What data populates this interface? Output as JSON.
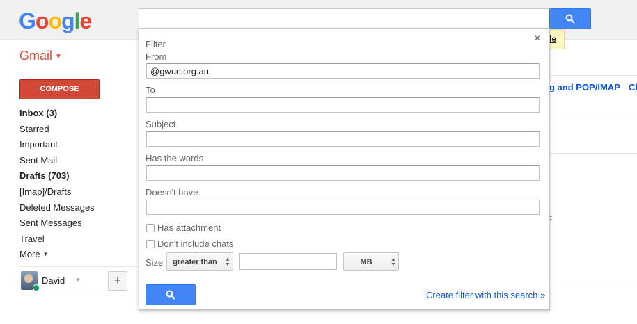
{
  "header": {
    "logo_letters": [
      {
        "ch": "G",
        "color": "#4285f4"
      },
      {
        "ch": "o",
        "color": "#ea4335"
      },
      {
        "ch": "o",
        "color": "#fbbc05"
      },
      {
        "ch": "g",
        "color": "#4285f4"
      },
      {
        "ch": "l",
        "color": "#34a853"
      },
      {
        "ch": "e",
        "color": "#ea4335"
      }
    ],
    "search_value": "",
    "search_icon": "magnifier-icon",
    "tooltip_text": "le"
  },
  "sidebar": {
    "app_label": "Gmail",
    "compose_label": "COMPOSE",
    "items": [
      {
        "label": "Inbox (3)",
        "bold": true
      },
      {
        "label": "Starred",
        "bold": false
      },
      {
        "label": "Important",
        "bold": false
      },
      {
        "label": "Sent Mail",
        "bold": false
      },
      {
        "label": "Drafts (703)",
        "bold": true
      },
      {
        "label": "[Imap]/Drafts",
        "bold": false
      },
      {
        "label": "Deleted Messages",
        "bold": false
      },
      {
        "label": "Sent Messages",
        "bold": false
      },
      {
        "label": "Travel",
        "bold": false
      }
    ],
    "more_label": "More",
    "user_name": "David",
    "add_label": "+"
  },
  "background": {
    "settings_link": "g and POP/IMAP",
    "settings_link_2": "Ch",
    "colon": ":"
  },
  "filter": {
    "title": "Filter",
    "close_label": "×",
    "from_label": "From",
    "from_value": "@gwuc.org.au",
    "to_label": "To",
    "to_value": "",
    "subject_label": "Subject",
    "subject_value": "",
    "has_words_label": "Has the words",
    "has_words_value": "",
    "doesnt_have_label": "Doesn't have",
    "doesnt_have_value": "",
    "has_attachment_label": "Has attachment",
    "has_attachment_checked": false,
    "no_chats_label": "Don't include chats",
    "no_chats_checked": false,
    "size_label": "Size",
    "size_operator": "greater than",
    "size_value": "",
    "size_unit": "MB",
    "create_filter_link": "Create filter with this search »"
  },
  "colors": {
    "accent_blue": "#4285f4",
    "compose_red": "#d14836",
    "link_blue": "#1155cc",
    "gmail_red": "#dd4b39"
  }
}
